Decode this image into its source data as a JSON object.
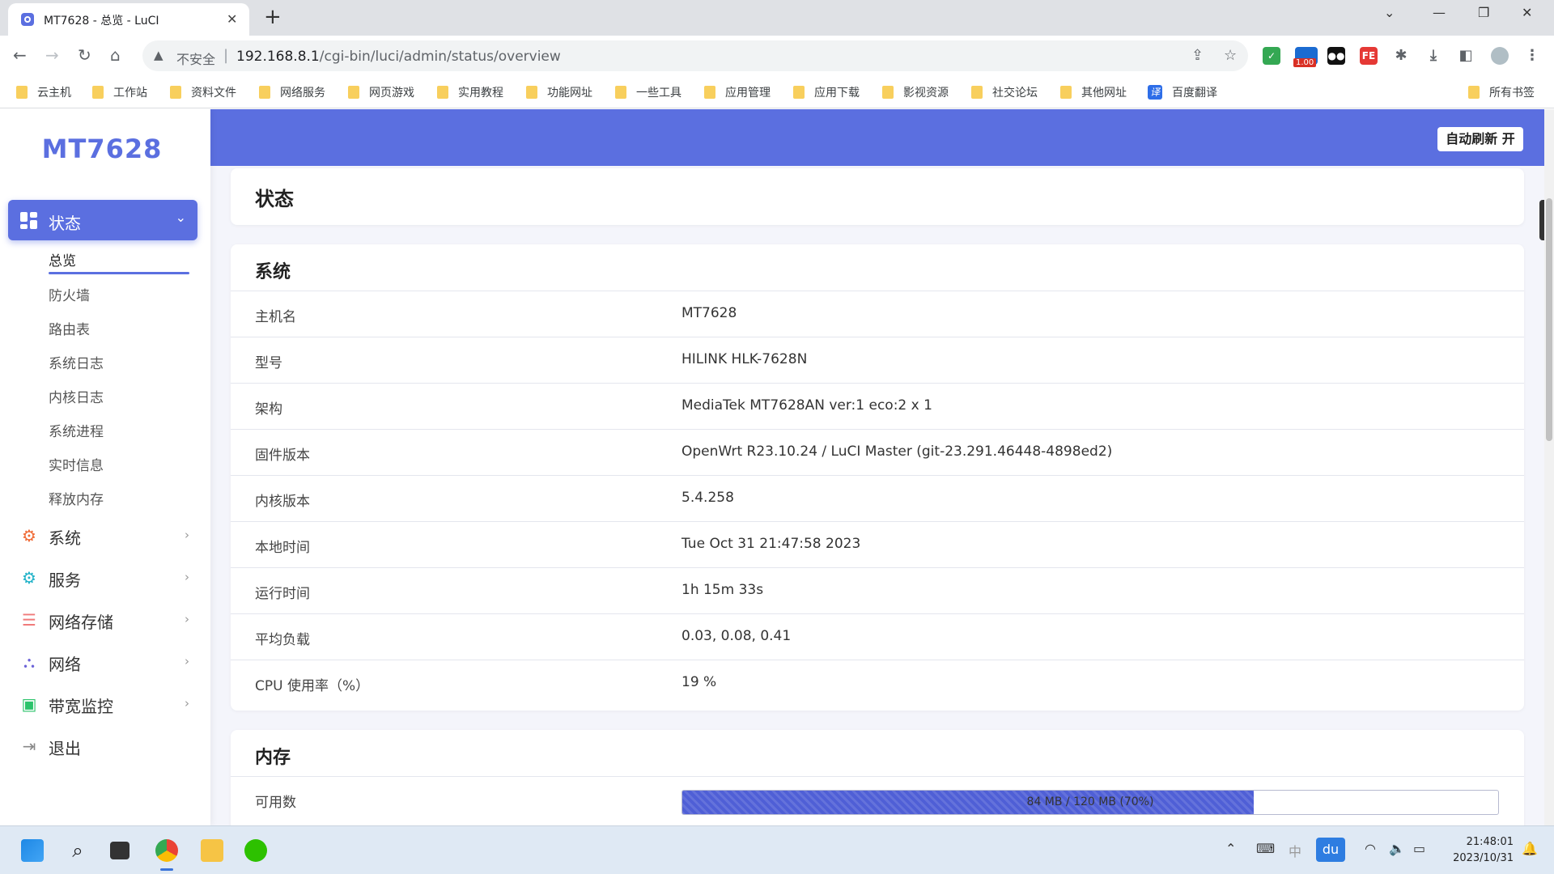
{
  "browser": {
    "tab_title": "MT7628 - 总览 - LuCI",
    "tab_close": "✕",
    "new_tab": "+",
    "address": {
      "insecure_label": "不安全",
      "host": "192.168.8.1",
      "path": "/cgi-bin/luci/admin/status/overview"
    },
    "extension_badge": "1.00",
    "bookmarks": [
      "云主机",
      "工作站",
      "资料文件",
      "网络服务",
      "网页游戏",
      "实用教程",
      "功能网址",
      "一些工具",
      "应用管理",
      "应用下载",
      "影视资源",
      "社交论坛",
      "其他网址",
      "百度翻译"
    ],
    "translate_icon_text": "译",
    "all_bookmarks": "所有书签"
  },
  "sidebar": {
    "brand": "MT7628",
    "active_menu": "状态",
    "sub_items": [
      "总览",
      "防火墙",
      "路由表",
      "系统日志",
      "内核日志",
      "系统进程",
      "实时信息",
      "释放内存"
    ],
    "active_sub": "总览",
    "menu_items": [
      {
        "label": "系统",
        "icon": "gear-icon",
        "color": "#f06a35"
      },
      {
        "label": "服务",
        "icon": "services-icon",
        "color": "#20b2c8"
      },
      {
        "label": "网络存储",
        "icon": "storage-icon",
        "color": "#f07a7a"
      },
      {
        "label": "网络",
        "icon": "network-icon",
        "color": "#6c63d8"
      },
      {
        "label": "带宽监控",
        "icon": "monitor-icon",
        "color": "#2cc36b"
      },
      {
        "label": "退出",
        "icon": "logout-icon",
        "color": "#888888"
      }
    ]
  },
  "header": {
    "auto_refresh": "自动刷新 开",
    "page_title": "状态"
  },
  "system": {
    "title": "系统",
    "rows": [
      {
        "key": "主机名",
        "value": "MT7628"
      },
      {
        "key": "型号",
        "value": "HILINK HLK-7628N"
      },
      {
        "key": "架构",
        "value": "MediaTek MT7628AN ver:1 eco:2 x 1"
      },
      {
        "key": "固件版本",
        "value": "OpenWrt R23.10.24 / LuCI Master (git-23.291.46448-4898ed2)"
      },
      {
        "key": "内核版本",
        "value": "5.4.258"
      },
      {
        "key": "本地时间",
        "value": "Tue Oct 31 21:47:58 2023"
      },
      {
        "key": "运行时间",
        "value": "1h 15m 33s"
      },
      {
        "key": "平均负载",
        "value": "0.03, 0.08, 0.41"
      },
      {
        "key": "CPU 使用率（%）",
        "value": "19 %"
      }
    ]
  },
  "memory": {
    "title": "内存",
    "available_label": "可用数",
    "available_text": "84 MB / 120 MB (70%)",
    "available_fraction": 0.7
  },
  "taskbar": {
    "time": "21:48:01",
    "date": "2023/10/31",
    "ime_label": "du",
    "input_mode": "中"
  },
  "colors": {
    "accent": "#5b6fe0",
    "progress": "#4f5fd6"
  }
}
